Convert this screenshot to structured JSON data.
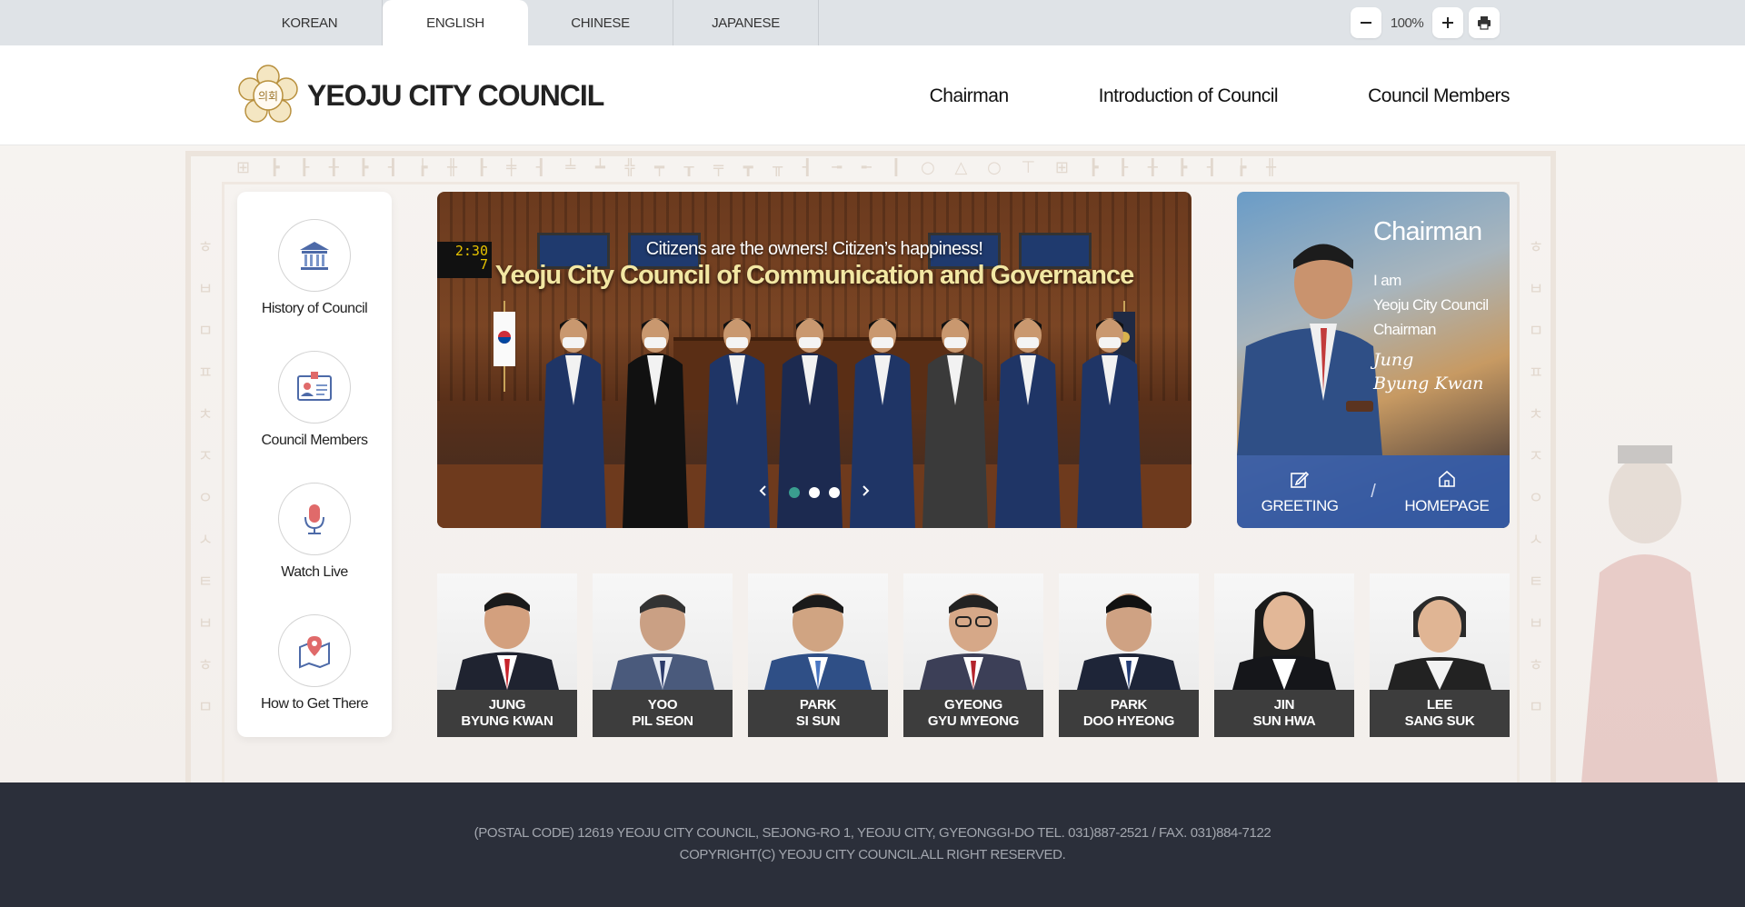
{
  "languages": {
    "items": [
      {
        "label": "KOREAN"
      },
      {
        "label": "ENGLISH"
      },
      {
        "label": "CHINESE"
      },
      {
        "label": "JAPANESE"
      }
    ],
    "active": "ENGLISH"
  },
  "zoom": {
    "value": "100%",
    "decrease_icon": "minus-icon",
    "increase_icon": "plus-icon",
    "print_icon": "print-icon"
  },
  "header": {
    "logo_text": "YEOJU CITY COUNCIL",
    "nav": [
      {
        "label": "Chairman"
      },
      {
        "label": "Introduction of Council"
      },
      {
        "label": "Council Members"
      }
    ]
  },
  "quick_menu": [
    {
      "label": "History of Council",
      "icon": "building-icon"
    },
    {
      "label": "Council Members",
      "icon": "id-card-icon"
    },
    {
      "label": "Watch Live",
      "icon": "microphone-icon"
    },
    {
      "label": "How to Get There",
      "icon": "map-pin-icon"
    }
  ],
  "slider": {
    "subtitle": "Citizens are the owners! Citizen’s happiness!",
    "title": "Yeoju City Council of Communication and Governance",
    "clock_text": "2:30\n7",
    "prev_icon": "chevron-left-icon",
    "next_icon": "chevron-right-icon",
    "slide_count": 3,
    "active_slide": 1
  },
  "chairman": {
    "title": "Chairman",
    "line1": "I am",
    "line2": "Yeoju City Council",
    "line3": "Chairman",
    "sign1": "Jung",
    "sign2": "Byung Kwan",
    "greeting_label": "GREETING",
    "homepage_label": "HOMEPAGE",
    "separator": "/"
  },
  "members": [
    {
      "line1": "JUNG",
      "line2": "BYUNG KWAN"
    },
    {
      "line1": "YOO",
      "line2": "PIL SEON"
    },
    {
      "line1": "PARK",
      "line2": "SI SUN"
    },
    {
      "line1": "GYEONG",
      "line2": "GYU MYEONG"
    },
    {
      "line1": "PARK",
      "line2": "DOO HYEONG"
    },
    {
      "line1": "JIN",
      "line2": "SUN HWA"
    },
    {
      "line1": "LEE",
      "line2": "SANG SUK"
    }
  ],
  "footer": {
    "address": "(POSTAL CODE) 12619 YEOJU CITY COUNCIL, SEJONG-RO 1, YEOJU CITY, GYEONGGI-DO TEL. 031)887-2521 / FAX. 031)884-7122",
    "copyright": "COPYRIGHT(C) YEOJU CITY COUNCIL.ALL RIGHT RESERVED."
  },
  "colors": {
    "topbar": "#dfe3e7",
    "footer": "#2b2f3a",
    "chairman_buttons": "#345caa",
    "slider_title": "#f2e7a3",
    "active_dot": "#3a9e8f"
  }
}
